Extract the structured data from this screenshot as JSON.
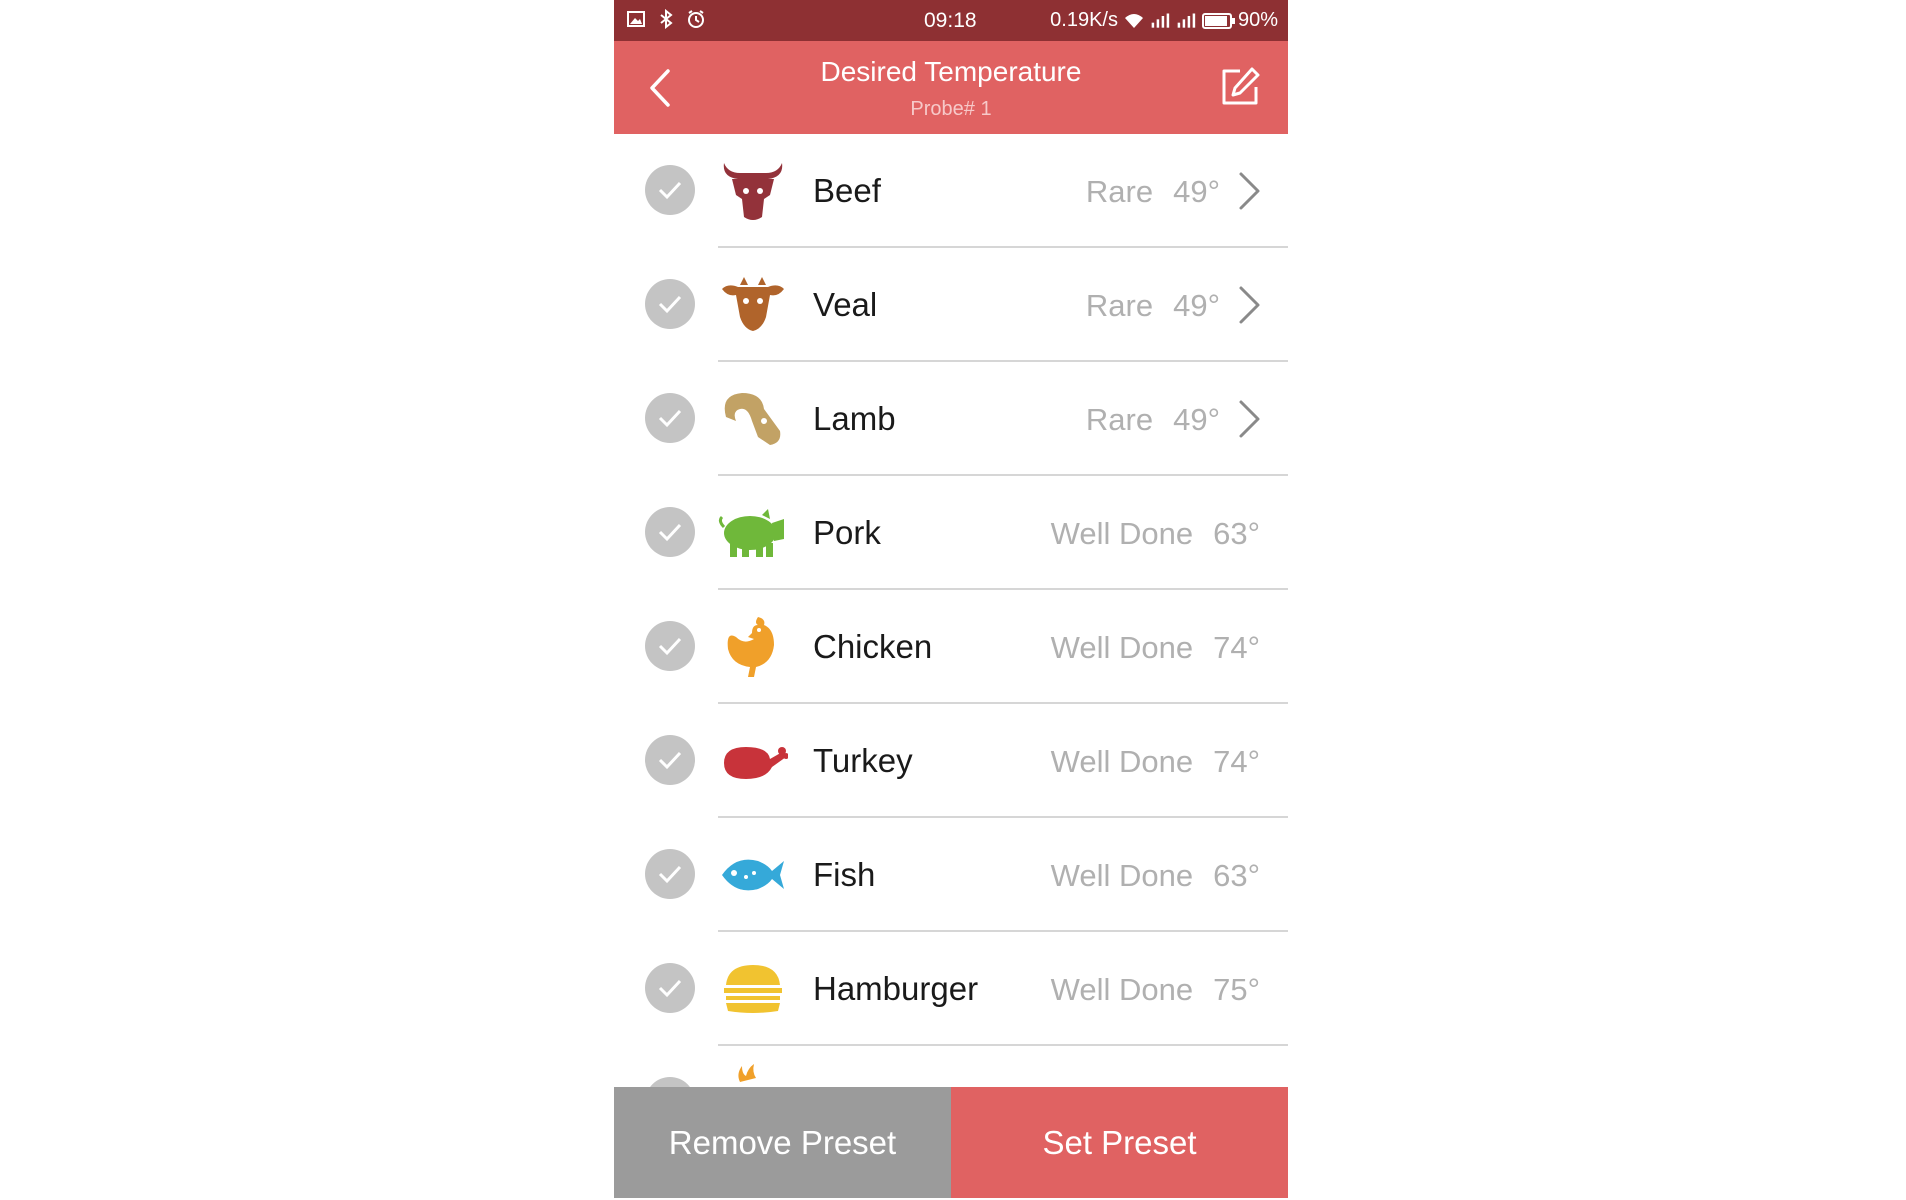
{
  "status_bar": {
    "time": "09:18",
    "speed": "0.19K/s",
    "battery": "90%",
    "icons": [
      "image-icon",
      "bluetooth-icon",
      "alarm-icon",
      "wifi-icon",
      "signal-icon",
      "signal-icon",
      "battery-icon"
    ]
  },
  "header": {
    "title": "Desired Temperature",
    "subtitle": "Probe# 1",
    "back_icon": "chevron-left-icon",
    "edit_icon": "edit-icon"
  },
  "colors": {
    "status_bar": "#8e3033",
    "header": "#e06262",
    "check": "#c4c4c4",
    "divider": "#d6d6d6",
    "remove_button": "#9b9b9b",
    "set_button": "#e06262"
  },
  "items": [
    {
      "name": "Beef",
      "doneness": "Rare",
      "temp": "49°",
      "icon": "bull-icon",
      "color": "#93323a",
      "has_chevron": true
    },
    {
      "name": "Veal",
      "doneness": "Rare",
      "temp": "49°",
      "icon": "calf-icon",
      "color": "#b0642b",
      "has_chevron": true
    },
    {
      "name": "Lamb",
      "doneness": "Rare",
      "temp": "49°",
      "icon": "ram-icon",
      "color": "#c2a265",
      "has_chevron": true
    },
    {
      "name": "Pork",
      "doneness": "Well Done",
      "temp": "63°",
      "icon": "pig-icon",
      "color": "#6fb83a",
      "has_chevron": false
    },
    {
      "name": "Chicken",
      "doneness": "Well Done",
      "temp": "74°",
      "icon": "rooster-icon",
      "color": "#f0a02a",
      "has_chevron": false
    },
    {
      "name": "Turkey",
      "doneness": "Well Done",
      "temp": "74°",
      "icon": "roast-turkey-icon",
      "color": "#c8333a",
      "has_chevron": false
    },
    {
      "name": "Fish",
      "doneness": "Well Done",
      "temp": "63°",
      "icon": "fish-icon",
      "color": "#35a9d9",
      "has_chevron": false
    },
    {
      "name": "Hamburger",
      "doneness": "Well Done",
      "temp": "75°",
      "icon": "hamburger-icon",
      "color": "#f1c330",
      "has_chevron": false
    }
  ],
  "buttons": {
    "remove": "Remove Preset",
    "set": "Set Preset"
  }
}
